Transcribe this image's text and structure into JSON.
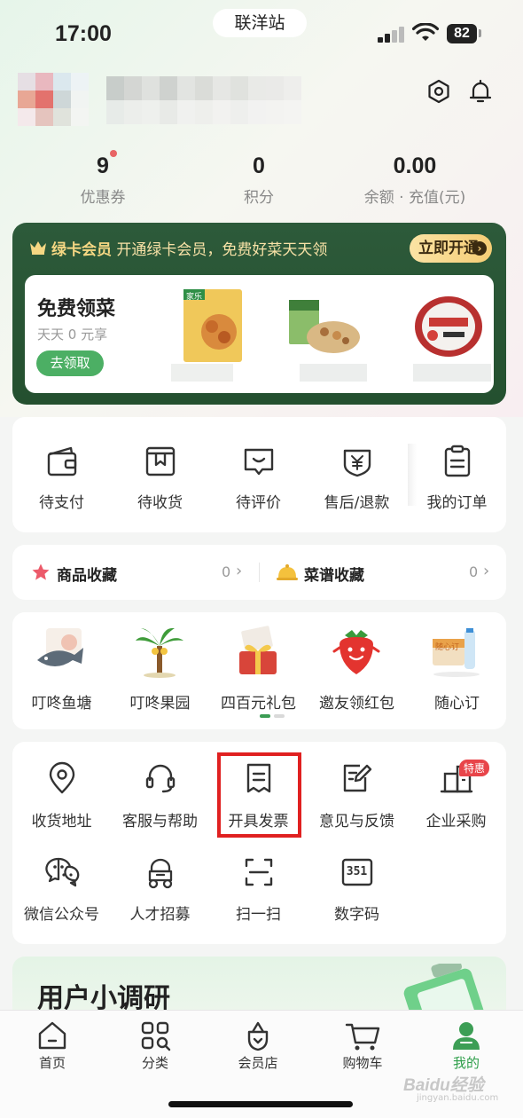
{
  "status_bar": {
    "time": "17:00",
    "store_name": "联洋站",
    "battery": "82"
  },
  "profile": {
    "stats": [
      {
        "value": "9",
        "label": "优惠券"
      },
      {
        "value": "0",
        "label": "积分"
      },
      {
        "value": "0.00",
        "label": "余额 · 充值(元)"
      }
    ]
  },
  "member_card": {
    "brand": "绿卡会员",
    "tagline": "开通绿卡会员，免费好菜天天领",
    "open_button": "立即开通",
    "free_veg": {
      "title": "免费领菜",
      "subtitle": "天天 0 元享",
      "button": "去领取"
    },
    "product_texts": [
      "家乐"
    ]
  },
  "orders": {
    "items": [
      {
        "label": "待支付",
        "icon": "wallet-icon"
      },
      {
        "label": "待收货",
        "icon": "package-icon"
      },
      {
        "label": "待评价",
        "icon": "comment-icon"
      },
      {
        "label": "售后/退款",
        "icon": "refund-icon"
      },
      {
        "label": "我的订单",
        "icon": "order-list-icon"
      }
    ]
  },
  "favorites": {
    "items": [
      {
        "label": "商品收藏",
        "count": "0",
        "icon": "star-icon"
      },
      {
        "label": "菜谱收藏",
        "count": "0",
        "icon": "bell-dish-icon"
      }
    ]
  },
  "activities": {
    "items": [
      {
        "label": "叮咚鱼塘",
        "icon": "fish-icon"
      },
      {
        "label": "叮咚果园",
        "icon": "palm-tree-icon"
      },
      {
        "label": "四百元礼包",
        "icon": "gift-icon"
      },
      {
        "label": "邀友领红包",
        "icon": "strawberry-icon"
      },
      {
        "label": "随心订",
        "icon": "subscribe-icon",
        "badge": "随心订"
      }
    ]
  },
  "functions": {
    "items": [
      {
        "label": "收货地址",
        "icon": "location-icon"
      },
      {
        "label": "客服与帮助",
        "icon": "headset-icon"
      },
      {
        "label": "开具发票",
        "icon": "invoice-icon"
      },
      {
        "label": "意见与反馈",
        "icon": "feedback-icon"
      },
      {
        "label": "企业采购",
        "icon": "enterprise-icon",
        "badge": "特惠"
      },
      {
        "label": "微信公众号",
        "icon": "wechat-icon"
      },
      {
        "label": "人才招募",
        "icon": "recruit-icon"
      },
      {
        "label": "扫一扫",
        "icon": "scan-icon"
      },
      {
        "label": "数字码",
        "icon": "digital-code-icon",
        "code": "351"
      }
    ]
  },
  "survey": {
    "title": "用户小调研"
  },
  "tabbar": {
    "items": [
      {
        "label": "首页",
        "icon": "home-icon",
        "active": false
      },
      {
        "label": "分类",
        "icon": "category-icon",
        "active": false
      },
      {
        "label": "会员店",
        "icon": "member-store-icon",
        "active": false
      },
      {
        "label": "购物车",
        "icon": "cart-icon",
        "active": false
      },
      {
        "label": "我的",
        "icon": "profile-icon",
        "active": true
      }
    ]
  },
  "watermark": {
    "text": "Baidu经验",
    "sub": "jingyan.baidu.com"
  },
  "colors": {
    "accent_green": "#2e9f4a",
    "member_dark": "#2d5a3a",
    "gold": "#f5cd75",
    "highlight_red": "#e02020"
  }
}
